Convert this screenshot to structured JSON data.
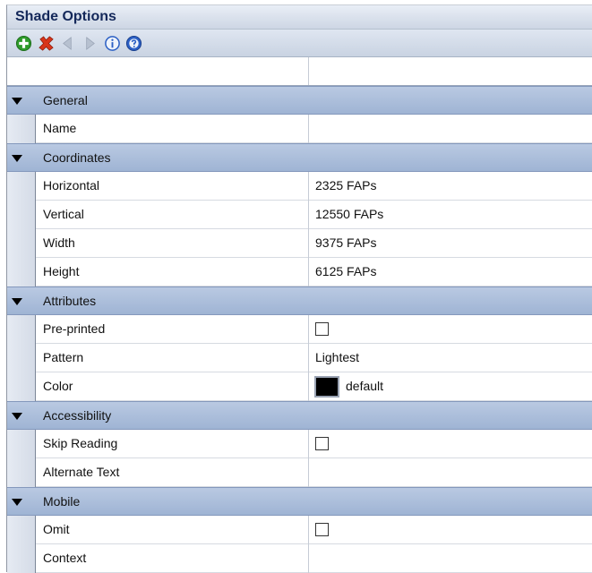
{
  "panel": {
    "title": "Shade Options"
  },
  "toolbar": {
    "buttons": [
      {
        "name": "add-icon",
        "color": "#2e9a2a"
      },
      {
        "name": "delete-icon",
        "color": "#d8341a"
      },
      {
        "name": "previous-icon",
        "color": "#b7c1d0"
      },
      {
        "name": "next-icon",
        "color": "#b7c1d0"
      },
      {
        "name": "info-icon",
        "color": "#2b5fc4"
      },
      {
        "name": "help-icon",
        "color": "#2b5fc4"
      }
    ]
  },
  "sections": {
    "general": {
      "label": "General",
      "rows": {
        "name": {
          "label": "Name",
          "value": ""
        }
      }
    },
    "coordinates": {
      "label": "Coordinates",
      "rows": {
        "horizontal": {
          "label": "Horizontal",
          "value": "2325 FAPs"
        },
        "vertical": {
          "label": "Vertical",
          "value": "12550 FAPs"
        },
        "width": {
          "label": "Width",
          "value": "9375 FAPs"
        },
        "height": {
          "label": "Height",
          "value": "6125 FAPs"
        }
      }
    },
    "attributes": {
      "label": "Attributes",
      "rows": {
        "preprinted": {
          "label": "Pre-printed",
          "checked": false
        },
        "pattern": {
          "label": "Pattern",
          "value": "Lightest"
        },
        "color": {
          "label": "Color",
          "value": "default",
          "swatch": "#000000"
        }
      }
    },
    "accessibility": {
      "label": "Accessibility",
      "rows": {
        "skip_reading": {
          "label": "Skip Reading",
          "checked": false
        },
        "alternate_text": {
          "label": "Alternate Text",
          "value": ""
        }
      }
    },
    "mobile": {
      "label": "Mobile",
      "rows": {
        "omit": {
          "label": "Omit",
          "checked": false
        },
        "context": {
          "label": "Context",
          "value": ""
        }
      }
    }
  }
}
